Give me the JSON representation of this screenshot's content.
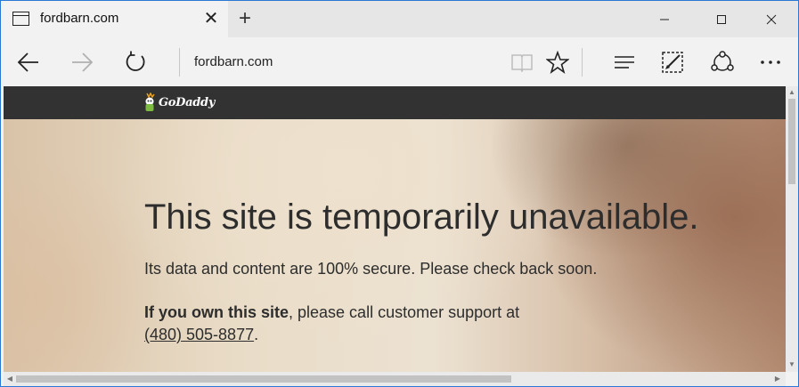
{
  "tab": {
    "title": "fordbarn.com",
    "close_glyph": "✕",
    "new_tab_glyph": "+"
  },
  "window_controls": {
    "minimize": "minimize-icon",
    "maximize": "maximize-icon",
    "close": "close-icon"
  },
  "navbar": {
    "address": "fordbarn.com",
    "icons": [
      "back-arrow-icon",
      "forward-arrow-icon",
      "refresh-icon",
      "reading-view-icon",
      "favorite-star-icon",
      "hub-icon",
      "web-note-icon",
      "share-icon",
      "more-icon"
    ]
  },
  "page": {
    "brand": "GoDaddy",
    "headline": "This site is temporarily unavailable.",
    "subtext": "Its data and content are 100% secure. Please check back soon.",
    "owner_bold": "If you own this site",
    "owner_rest": ", please call customer support at",
    "phone": "(480) 505-8877",
    "phone_suffix": "."
  },
  "colors": {
    "window_border": "#2b78d4",
    "godaddy_bar": "#323232",
    "text": "#2d2d2d"
  }
}
